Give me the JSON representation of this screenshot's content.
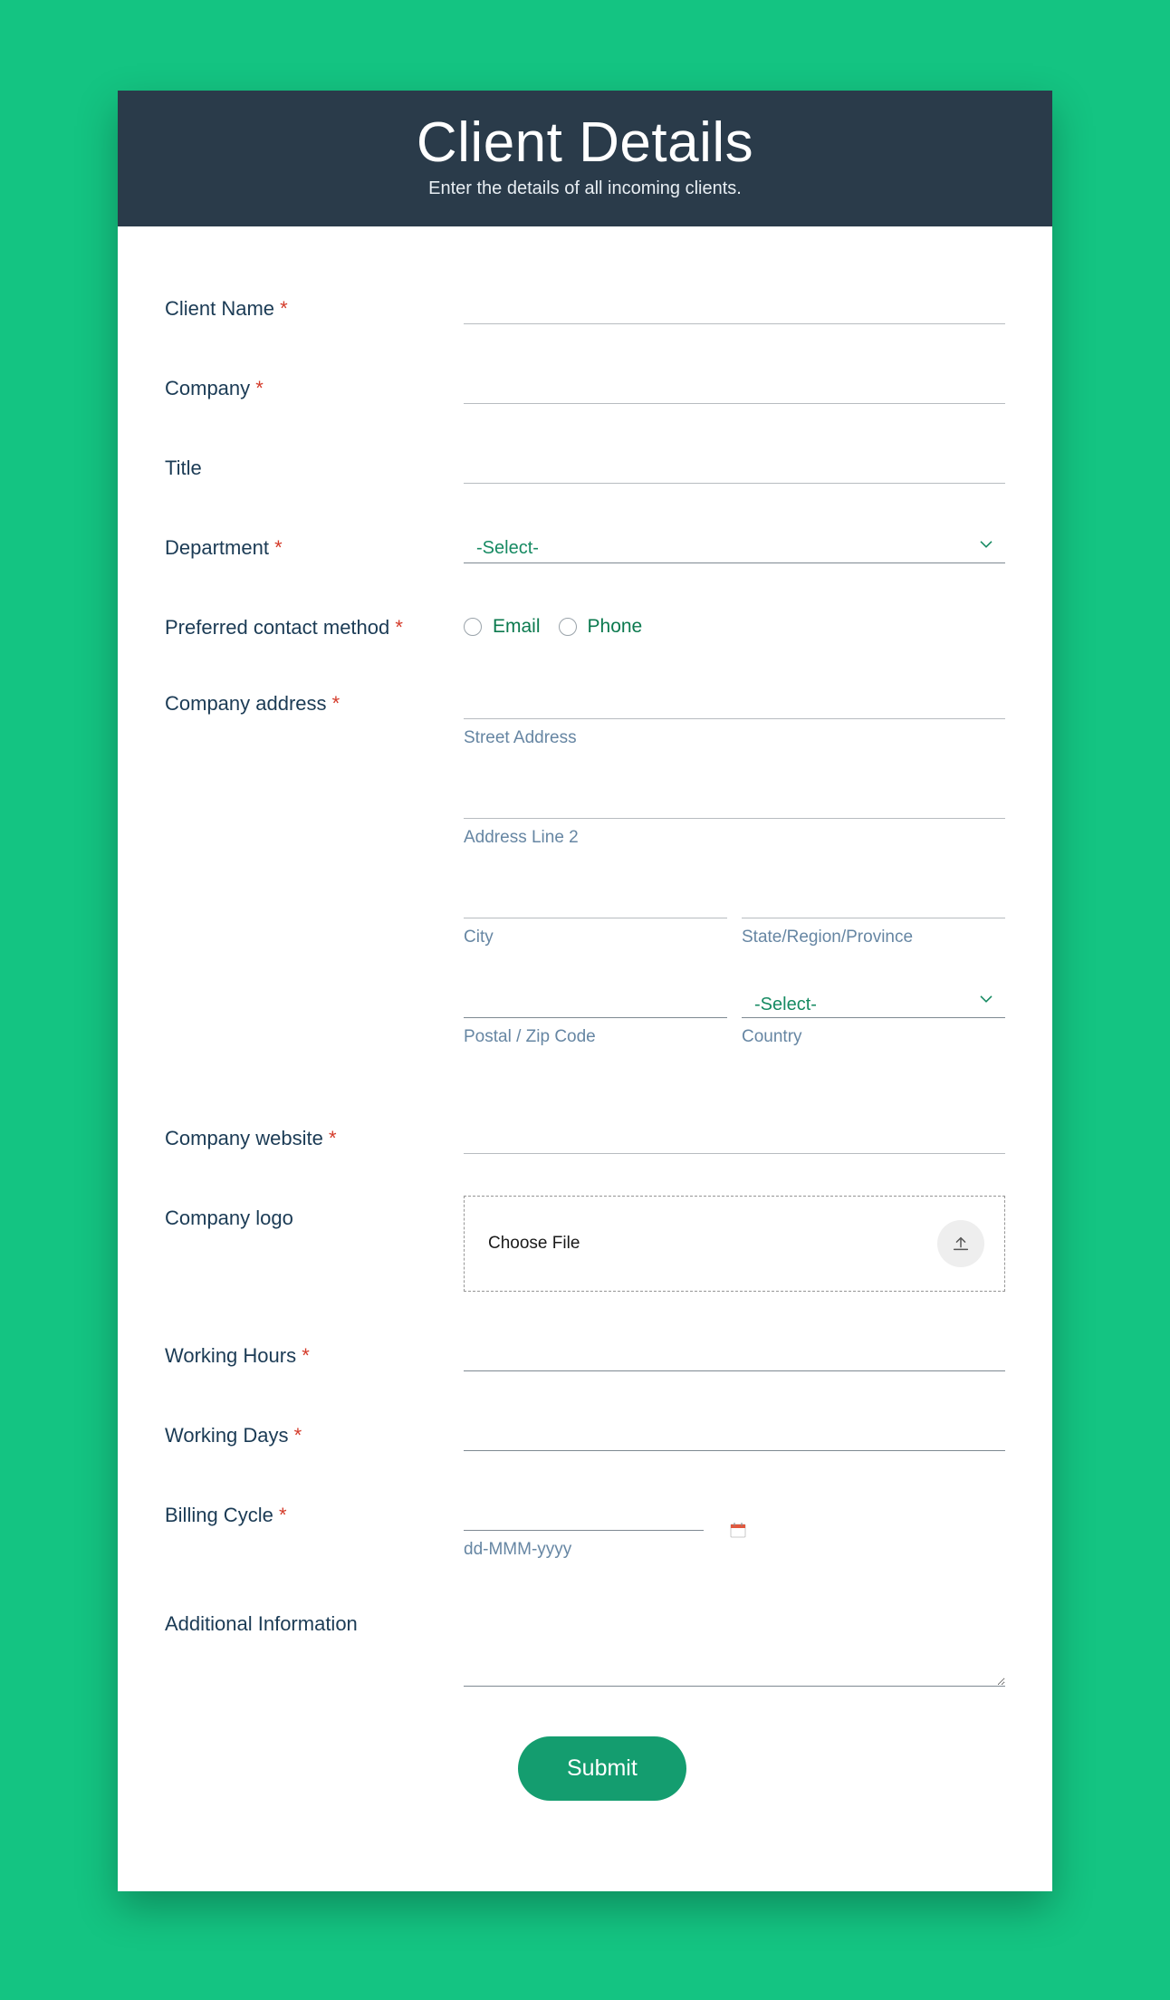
{
  "header": {
    "title": "Client Details",
    "subtitle": "Enter the details of all incoming clients."
  },
  "fields": {
    "client_name": "Client Name",
    "company": "Company",
    "title": "Title",
    "department": "Department",
    "contact_method": "Preferred contact method",
    "company_address": "Company address",
    "company_website": "Company website",
    "company_logo": "Company logo",
    "working_hours": "Working Hours",
    "working_days": "Working Days",
    "billing_cycle": "Billing Cycle",
    "additional_info": "Additional Information"
  },
  "select_placeholder": "-Select-",
  "contact_options": {
    "email": "Email",
    "phone": "Phone"
  },
  "address_labels": {
    "street": "Street Address",
    "line2": "Address Line 2",
    "city": "City",
    "state": "State/Region/Province",
    "postal": "Postal / Zip Code",
    "country": "Country"
  },
  "upload": {
    "choose_file": "Choose File"
  },
  "date_format": "dd-MMM-yyyy",
  "submit_label": "Submit",
  "required_marker": "*"
}
